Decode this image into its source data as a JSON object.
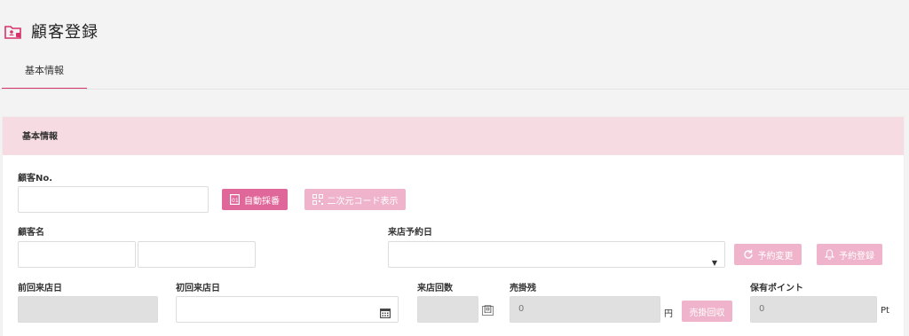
{
  "page": {
    "title": "顧客登録"
  },
  "tabs": [
    {
      "label": "基本情報"
    }
  ],
  "panel": {
    "title": "基本情報"
  },
  "form": {
    "customer_no": {
      "label": "顧客No.",
      "value": ""
    },
    "auto_number_button": "自動採番",
    "qr_button": "二次元コード表示",
    "customer_name": {
      "label": "顧客名",
      "last": "",
      "first": ""
    },
    "reservation_date": {
      "label": "来店予約日",
      "value": ""
    },
    "change_reservation_button": "予約変更",
    "register_reservation_button": "予約登録",
    "last_visit": {
      "label": "前回来店日",
      "value": ""
    },
    "first_visit": {
      "label": "初回来店日",
      "value": ""
    },
    "visit_count": {
      "label": "来店回数",
      "value": "",
      "unit": "回"
    },
    "receivable": {
      "label": "売掛残",
      "value": "0",
      "unit": "円",
      "button": "売掛回収"
    },
    "points": {
      "label": "保有ポイント",
      "value": "0",
      "unit": "Pt"
    }
  },
  "colors": {
    "accent": "#d6336c",
    "button": "#e0679a",
    "button_light": "#efb4cb",
    "panel_header": "#f7dbe3"
  }
}
